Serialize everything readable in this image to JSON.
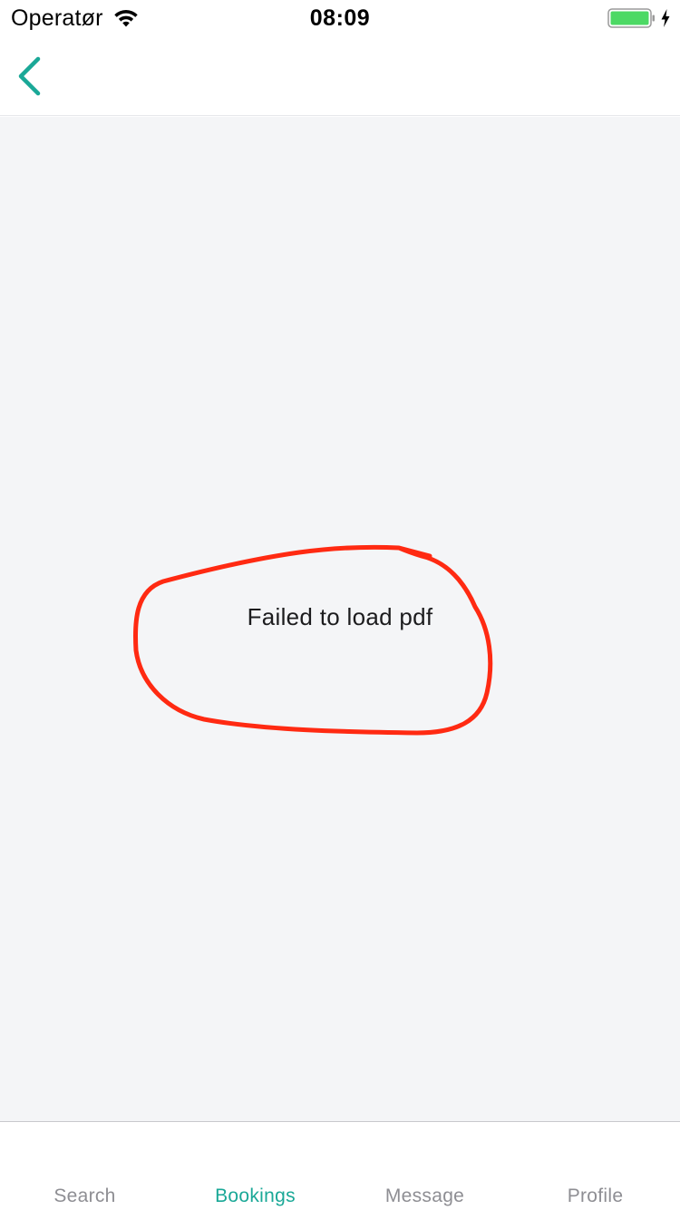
{
  "status_bar": {
    "carrier": "Operatør",
    "time": "08:09",
    "icons": [
      "wifi-icon",
      "battery-icon",
      "charging-bolt-icon"
    ],
    "battery_color": "#4cd964"
  },
  "nav_bar": {
    "back_icon": "chevron-left-icon",
    "accent_color": "#1aa897"
  },
  "content": {
    "message": "Failed to load pdf",
    "annotation_color": "#ff2a12",
    "background_color": "#f4f5f7"
  },
  "tab_bar": {
    "active_tab": "Bookings",
    "active_color": "#1aa897",
    "inactive_color": "#8e8e93",
    "tabs": [
      {
        "label": "Search"
      },
      {
        "label": "Bookings"
      },
      {
        "label": "Message"
      },
      {
        "label": "Profile"
      }
    ]
  }
}
